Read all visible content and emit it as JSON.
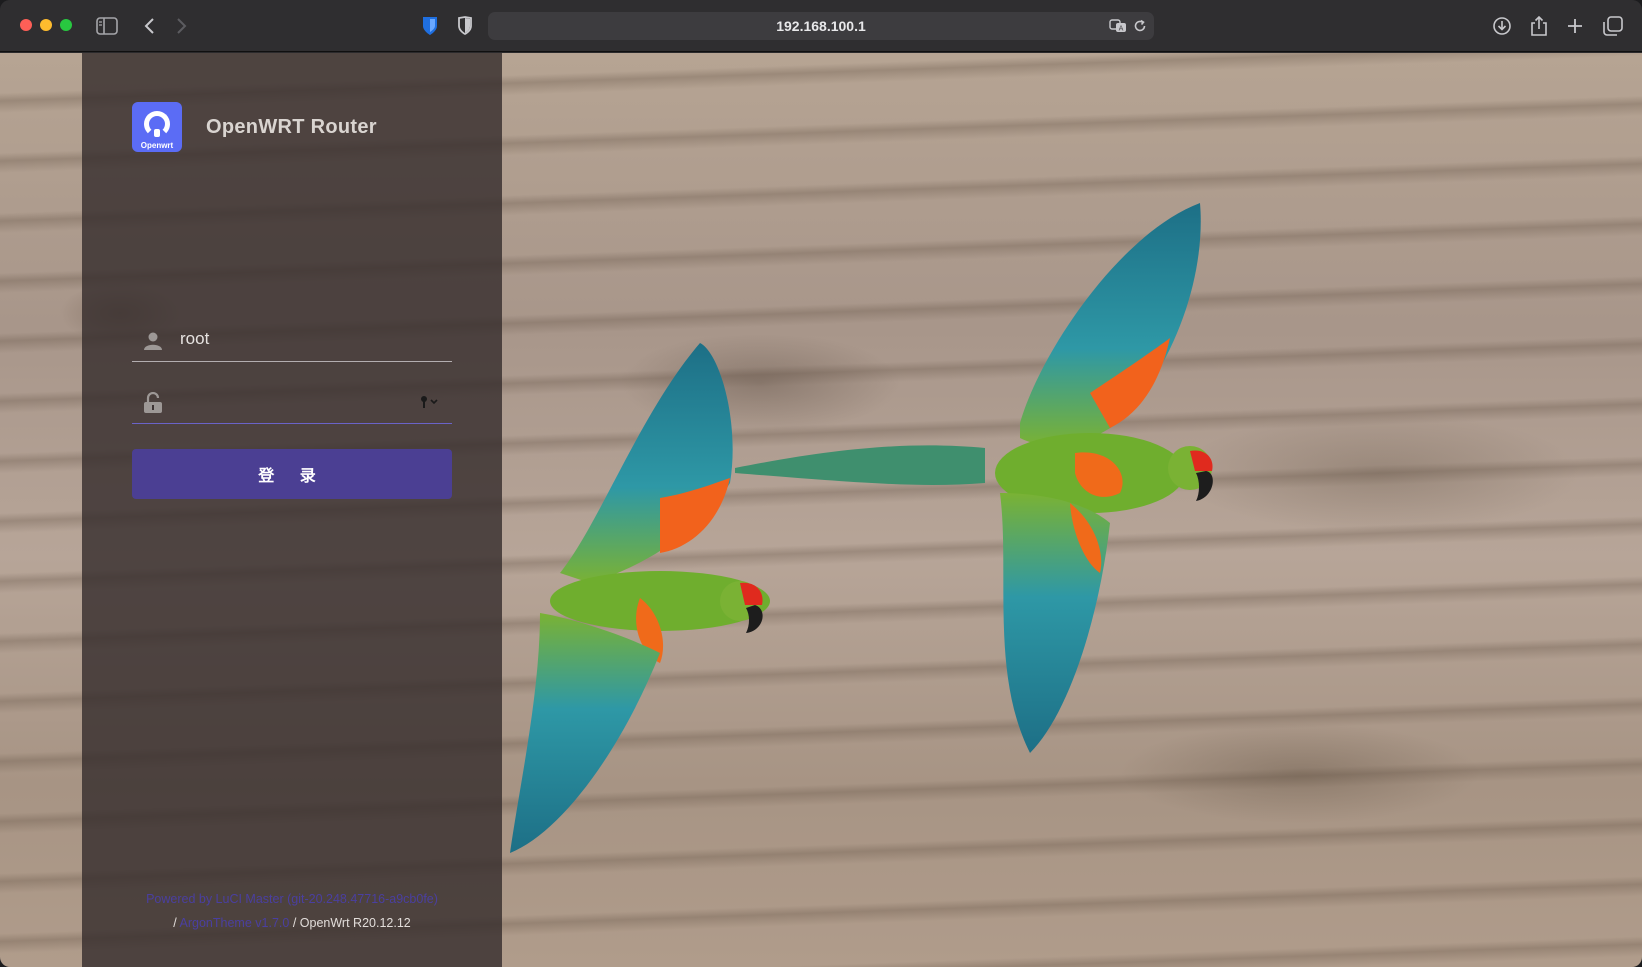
{
  "browser": {
    "url": "192.168.100.1"
  },
  "login": {
    "brand_logo_text": "Openwrt",
    "brand_name": "OpenWRT Router",
    "username_value": "root",
    "password_value": "",
    "submit_label": "登 录"
  },
  "footer": {
    "powered_by": "Powered by LuCI Master (git-20.248.47716-a9cb0fe)",
    "sep1": "/",
    "theme": "ArgonTheme v1.7.0",
    "sep2": "/",
    "firmware": "OpenWrt R20.12.12"
  },
  "colors": {
    "accent": "#4b3f93",
    "logo": "#5b6cf5",
    "panel": "#342c2c"
  }
}
